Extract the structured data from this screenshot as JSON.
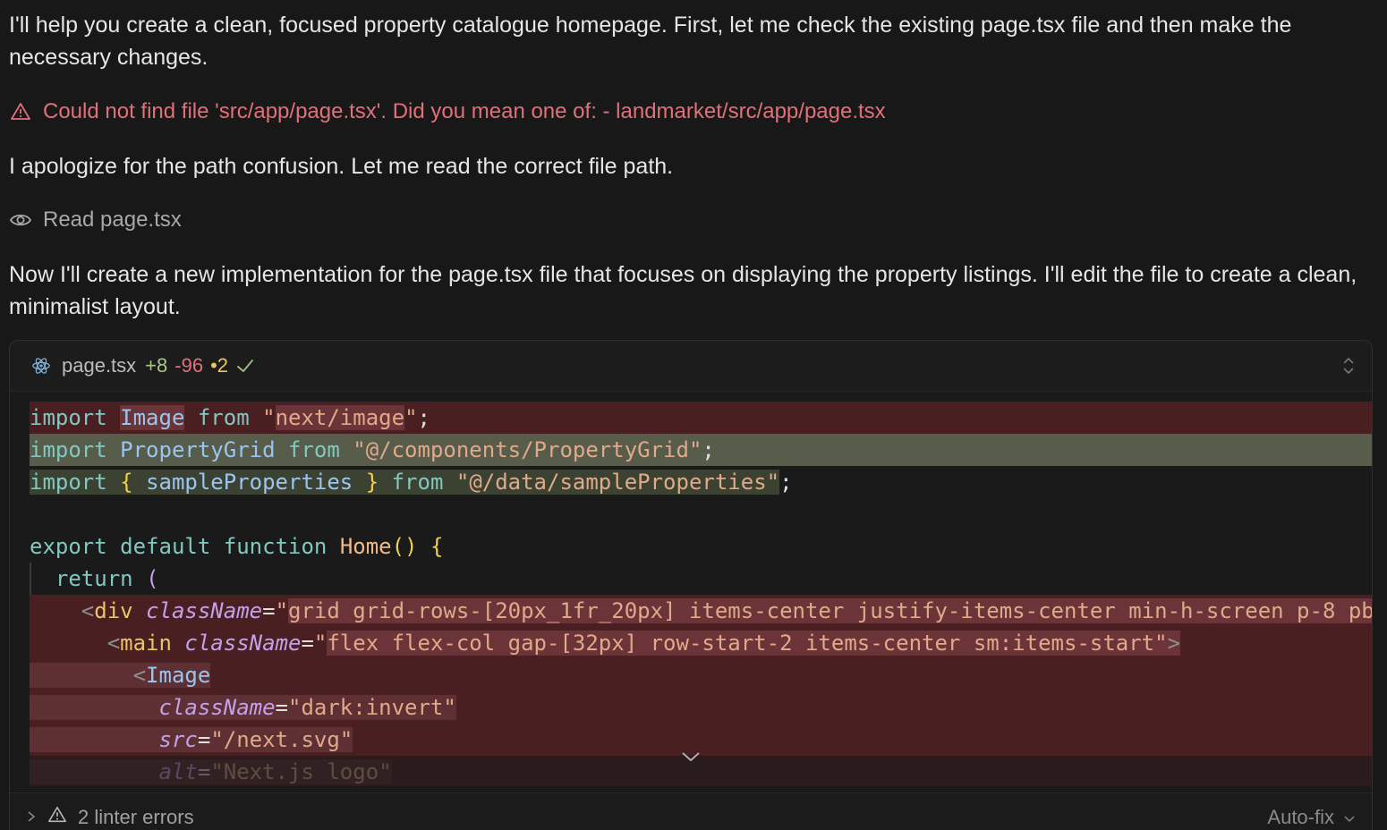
{
  "messages": {
    "intro": "I'll help you create a clean, focused property catalogue homepage. First, let me check the existing page.tsx file and then make the necessary changes.",
    "error": "Could not find file 'src/app/page.tsx'. Did you mean one of: - landmarket/src/app/page.tsx",
    "apology": "I apologize for the path confusion. Let me read the correct file path.",
    "read_action": "Read page.tsx",
    "plan": "Now I'll create a new implementation for the page.tsx file that focuses on displaying the property listings. I'll edit the file to create a clean, minimalist layout."
  },
  "diff_panel": {
    "file_name": "page.tsx",
    "added": "+8",
    "removed": "-96",
    "modified": "•2",
    "icons": {
      "file": "react-icon",
      "status": "check-icon",
      "toggle": "chevron-updown-icon"
    },
    "code": {
      "l1": {
        "kw": "import",
        "id": "Image",
        "from": "from",
        "q1": "\"",
        "str": "next/image",
        "q2": "\"",
        "end": ";"
      },
      "l2": {
        "kw": "import",
        "id": "PropertyGrid",
        "from": "from",
        "q1": "\"",
        "str": "@/components/PropertyGrid",
        "q2": "\"",
        "end": ";"
      },
      "l3": {
        "kw": "import",
        "ob": "{",
        "id": "sampleProperties",
        "cb": "}",
        "from": "from",
        "q1": "\"",
        "str": "@/data/sampleProperties",
        "q2": "\"",
        "end": ";"
      },
      "l5": {
        "kw1": "export",
        "kw2": "default",
        "kw3": "function",
        "fn": "Home",
        "paren": "()",
        "ob": "{"
      },
      "l6": {
        "kw": "return",
        "paren": "("
      },
      "l7": {
        "lt": "<",
        "tag": "div",
        "attr": "className",
        "eq": "=",
        "q1": "\"",
        "val": "grid grid-rows-[20px_1fr_20px] items-center justify-items-center min-h-screen p-8 pb"
      },
      "l8": {
        "lt": "<",
        "tag": "main",
        "attr": "className",
        "eq": "=",
        "q1": "\"",
        "val": "flex flex-col gap-[32px] row-start-2 items-center sm:items-start",
        "q2": "\"",
        "gt": ">"
      },
      "l9": {
        "lt": "<",
        "tag": "Image"
      },
      "l10": {
        "attr": "className",
        "eq": "=",
        "val": "\"dark:invert\""
      },
      "l11": {
        "attr": "src",
        "eq": "=",
        "val": "\"/next.svg\""
      },
      "l12": {
        "attr": "alt",
        "eq": "=",
        "val": "\"Next.js logo\""
      }
    },
    "footer": {
      "linter": "2 linter errors",
      "autofix": "Auto-fix"
    }
  }
}
